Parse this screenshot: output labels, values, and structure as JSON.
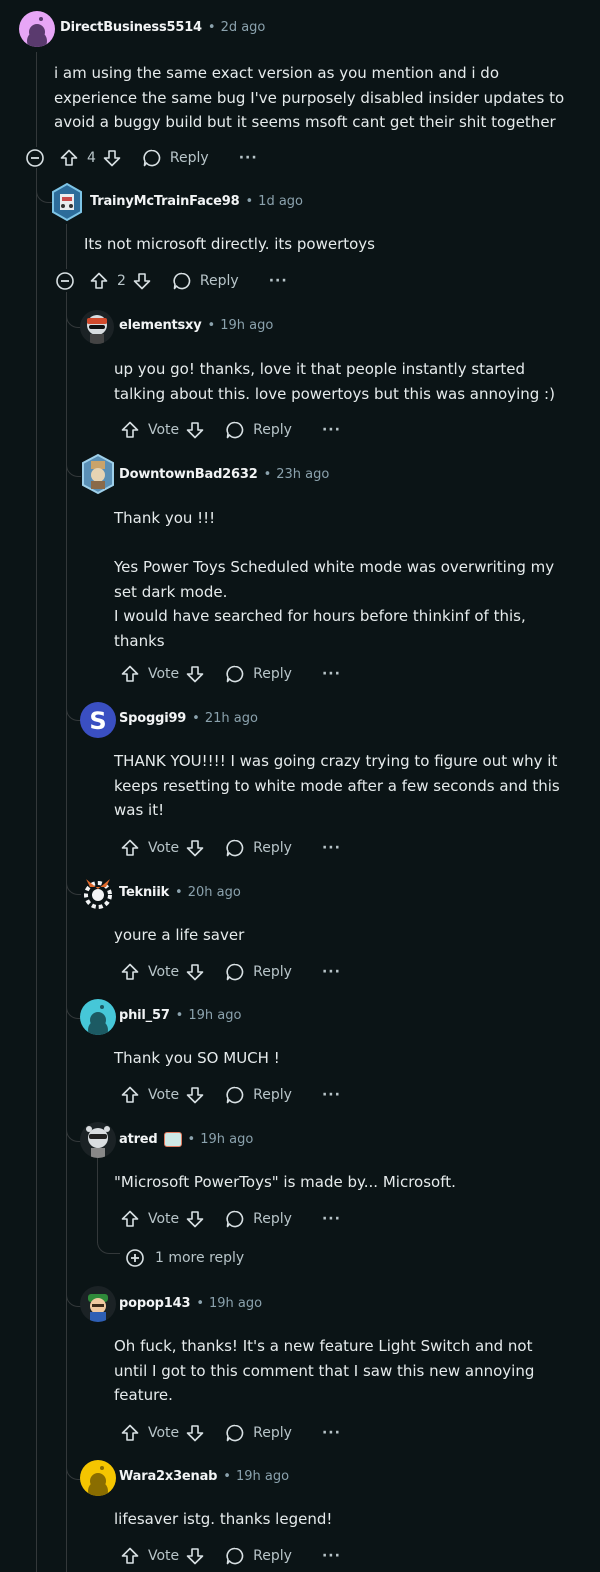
{
  "comments": [
    {
      "user": "DirectBusiness5514",
      "time": "2d ago",
      "lines": [
        "i am using the same exact version as you mention and i do",
        "experience the same bug I've purposely disabled insider updates to",
        "avoid a buggy build but it seems msoft cant get their shit together"
      ],
      "vote": "4",
      "reply": "Reply",
      "more": "···"
    },
    {
      "user": "TrainyMcTrainFace98",
      "time": "1d ago",
      "lines": [
        "Its not microsoft directly. its powertoys"
      ],
      "vote": "2",
      "reply": "Reply",
      "more": "···"
    },
    {
      "user": "elementsxy",
      "time": "19h ago",
      "lines": [
        "up you go! thanks, love it that people instantly started",
        "talking about this. love powertoys but this was annoying :)"
      ],
      "vote": "Vote",
      "reply": "Reply",
      "more": "···"
    },
    {
      "user": "DowntownBad2632",
      "time": "23h ago",
      "lines": [
        "Thank you !!!",
        "",
        "Yes Power Toys Scheduled white mode was overwriting my",
        "set dark mode.",
        "I would have searched for hours before thinkinf of this,",
        "thanks"
      ],
      "vote": "Vote",
      "reply": "Reply",
      "more": "···"
    },
    {
      "user": "Spoggi99",
      "time": "21h ago",
      "lines": [
        "THANK YOU!!!! I was going crazy trying to figure out why it",
        "keeps resetting to white mode after a few seconds and this",
        "was it!"
      ],
      "vote": "Vote",
      "reply": "Reply",
      "more": "···"
    },
    {
      "user": "Tekniik",
      "time": "20h ago",
      "lines": [
        "youre a life saver"
      ],
      "vote": "Vote",
      "reply": "Reply",
      "more": "···"
    },
    {
      "user": "phil_57",
      "time": "19h ago",
      "lines": [
        "Thank you SO MUCH !"
      ],
      "vote": "Vote",
      "reply": "Reply",
      "more": "···"
    },
    {
      "user": "atred",
      "time": "19h ago",
      "lines": [
        "\"Microsoft PowerToys\" is made by... Microsoft."
      ],
      "vote": "Vote",
      "reply": "Reply",
      "more": "···"
    },
    {
      "user": "popop143",
      "time": "19h ago",
      "lines": [
        "Oh fuck, thanks! It's a new feature Light Switch and not",
        "until I got to this comment that I saw this new annoying",
        "feature."
      ],
      "vote": "Vote",
      "reply": "Reply",
      "more": "···"
    },
    {
      "user": "Wara2x3enab",
      "time": "19h ago",
      "lines": [
        "lifesaver istg. thanks legend!"
      ],
      "vote": "Vote",
      "reply": "Reply",
      "more": "···"
    }
  ],
  "more_replies": "1 more reply",
  "colors": {
    "background": "#0b1416",
    "text": "#f2f4f5",
    "meta": "#8ba2ad",
    "thread_line": "#33383a"
  }
}
